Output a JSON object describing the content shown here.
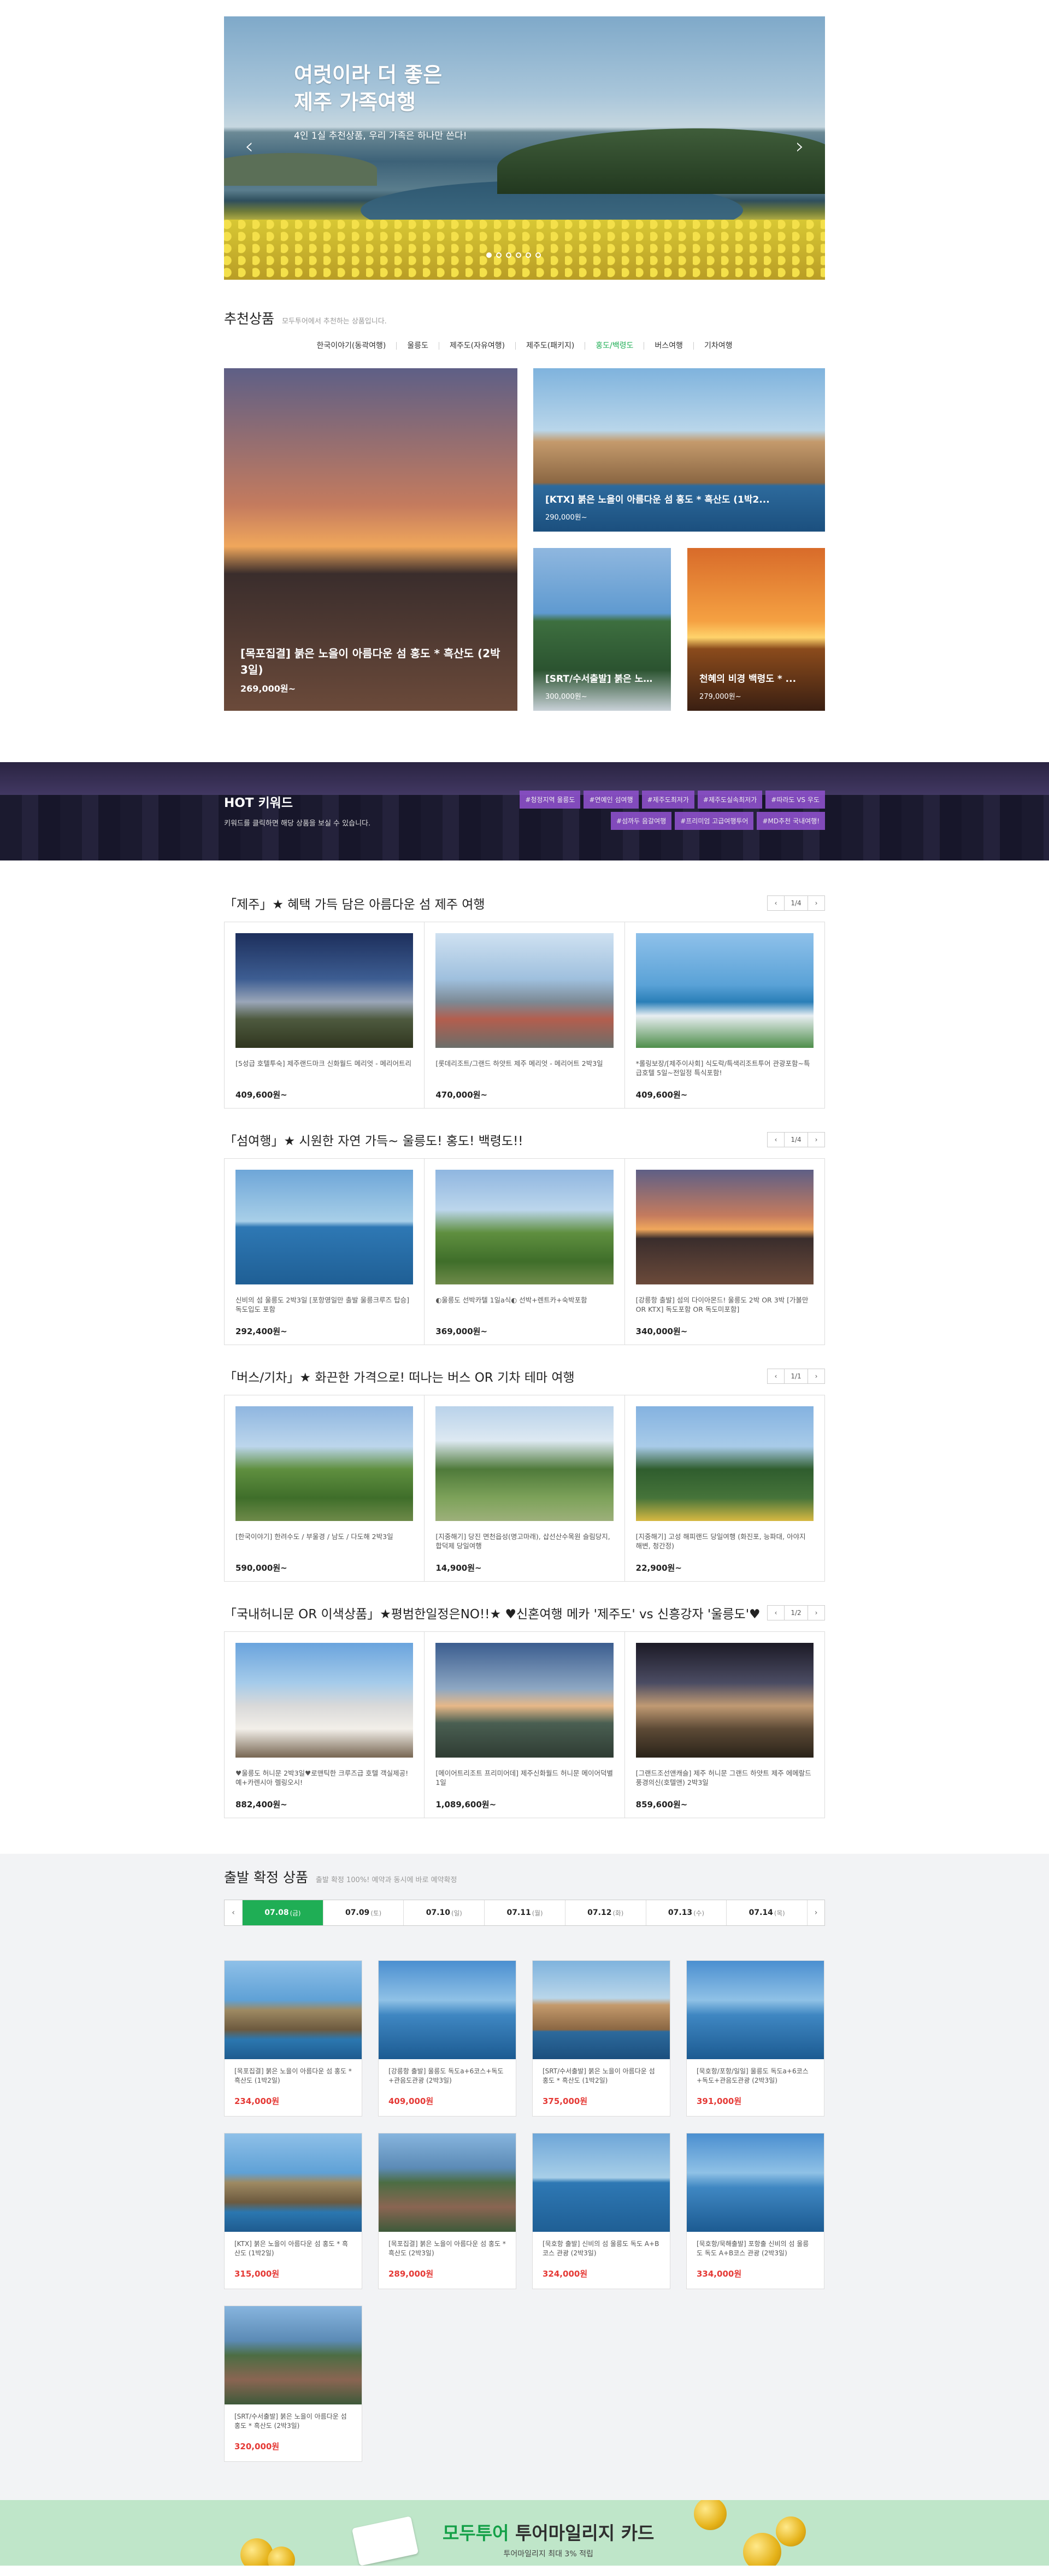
{
  "hero": {
    "title_line1": "여럿이라 더 좋은",
    "title_line2": "제주 가족여행",
    "subtitle": "4인 1실 추천상품, 우리 가족은 하나만 쓴다!",
    "prev_icon": "‹",
    "next_icon": "›",
    "slide_count": 6,
    "active_slide": 1
  },
  "recommend": {
    "title": "추천상품",
    "subtitle": "모두투어에서 추천하는 상품입니다.",
    "tabs": [
      "한국이야기(동곽여행)",
      "울릉도",
      "제주도(자유여행)",
      "제주도(패키지)",
      "홍도/백령도",
      "버스여행",
      "기차여행"
    ],
    "active_tab": "홍도/백령도",
    "cards": [
      {
        "title": "[목포집결] 붉은 노을이 아름다운 섬 홍도 * 흑산도 (2박3일)",
        "price": "269,000원~"
      },
      {
        "title": "[KTX] 붉은 노을이 아름다운 섬 홍도 * 흑산도 (1박2...",
        "price": "290,000원~"
      },
      {
        "title": "[SRT/수서출발] 붉은 노을이 아름다운 섬 홍도 * 흑산도...",
        "price": "300,000원~"
      },
      {
        "title": "천혜의 비경 백령도 * ...",
        "price": "279,000원~"
      }
    ]
  },
  "hot": {
    "title": "HOT 키워드",
    "subtitle": "키워드를 클릭하면 해당 상품을 보실 수 있습니다.",
    "tags": [
      "#청정지역 울릉도",
      "#연예인 섬여행",
      "#제주도최저가",
      "#제주도실속최저가",
      "#따라도 VS 우도",
      "#섬까두 음갈여행",
      "#프리미엄 고급여행투어",
      "#MD추천 국내여행!"
    ]
  },
  "sections": [
    {
      "title": "「제주」★ 혜택 가득 담은 아름다운 섬 제주 여행",
      "page": "1/4",
      "items": [
        {
          "title": "[5성급 호텔투숙] 제주랜드마크 신화월드 메리엇 - 메리어트리",
          "price": "409,600원~"
        },
        {
          "title": "[롯데리조트/그랜드 하얏트 제주 메리엇 - 메리어트 2박3일",
          "price": "470,000원~"
        },
        {
          "title": "*롤링보장/[제주이사회] 식도락/특색리조트투어 관광포함~특급호텔 5일~전일정 특식포함!",
          "price": "409,600원~"
        }
      ]
    },
    {
      "title": "「섬여행」★ 시원한 자연 가득~ 울릉도! 홍도! 백령도!!",
      "page": "1/4",
      "items": [
        {
          "title": "신비의 섬 울릉도 2박3일 [포항영일만 출발 울릉크루즈 탑승] 독도입도 포함",
          "price": "292,400원~"
        },
        {
          "title": "◐울릉도 선박카텔 1일a식◐ 선박+렌트카+숙박포함",
          "price": "369,000원~"
        },
        {
          "title": "[강릉항 출발] 섬의 다이아몬드! 울릉도 2박 OR 3박 [가볼만 OR KTX] 독도포함 OR 독도미포함]",
          "price": "340,000원~"
        }
      ]
    },
    {
      "title": "「버스/기차」★ 화끈한 가격으로! 떠나는 버스 OR 기차 테마 여행",
      "page": "1/1",
      "items": [
        {
          "title": "[한국이야기] 한려수도 / 부울경 / 남도 / 다도해 2박3일",
          "price": "590,000원~"
        },
        {
          "title": "[지중해기] 당진 면천읍성(명고마래), 삽선산수목원 슬림당지, 합덕제 당일여행",
          "price": "14,900원~"
        },
        {
          "title": "[지중해기] 고성 해피랜드 당일여행 (화진포, 능파대, 아야지 해변, 청간정)",
          "price": "22,900원~"
        }
      ]
    },
    {
      "title": "「국내허니문 OR 이색상품」★평범한일정은NO!!★ ♥신혼여행 메카 '제주도' vs 신흥강자 '울릉도'♥",
      "page": "1/2",
      "items": [
        {
          "title": "♥울릉도 허니문 2박3일♥로맨틱한 크루즈급 호텔 객실제공! 예+카렌시아 렐링오시!",
          "price": "882,400원~"
        },
        {
          "title": "[메이어트리조트 프리미어데] 제주신화월드 허니문 메이어덕별1일",
          "price": "1,089,600원~"
        },
        {
          "title": "[그랜드조선앤캐슬] 제주 허니문 그랜드 하얏트 제주 에메랄드 풍경의신(호텔앤) 2박3일",
          "price": "859,600원~"
        }
      ]
    }
  ],
  "confirm": {
    "title": "출발 확정 상품",
    "subtitle": "출발 확정 100%! 예약과 동시에 바로 예약확정",
    "prev_icon": "‹",
    "next_icon": "›",
    "dates": [
      {
        "date": "07.08",
        "day": "(금)"
      },
      {
        "date": "07.09",
        "day": "(토)"
      },
      {
        "date": "07.10",
        "day": "(일)"
      },
      {
        "date": "07.11",
        "day": "(월)"
      },
      {
        "date": "07.12",
        "day": "(화)"
      },
      {
        "date": "07.13",
        "day": "(수)"
      },
      {
        "date": "07.14",
        "day": "(목)"
      }
    ],
    "active_date": "07.08",
    "items": [
      {
        "title": "[목포집결] 붉은 노을이 아름다운 섬 홍도 * 흑산도 (1박2일)",
        "price": "234,000원"
      },
      {
        "title": "[강릉항 출발] 울릉도 독도a+6코스+독도+관음도관광 (2박3일)",
        "price": "409,000원"
      },
      {
        "title": "[SRT/수서출발] 붉은 노을이 아름다운 섬 홍도 * 흑산도 (1박2일)",
        "price": "375,000원"
      },
      {
        "title": "[묵호항/포항/일일] 울릉도 독도a+6코스+독도+관음도관광 (2박3일)",
        "price": "391,000원"
      },
      {
        "title": "[KTX] 붉은 노을이 아름다운 섬 홍도 * 흑산도 (1박2일)",
        "price": "315,000원"
      },
      {
        "title": "[목포집결] 붉은 노을이 아름다운 섬 홍도 * 흑산도 (2박3일)",
        "price": "289,000원"
      },
      {
        "title": "[묵호항 출발] 신비의 섬 울릉도 독도 A+B코스 관광 (2박3일)",
        "price": "324,000원"
      },
      {
        "title": "[묵호항/묵해출발] 포항출 신비의 섬 울릉도 독도 A+B코스 관광 (2박3일)",
        "price": "334,000원"
      },
      {
        "title": "[SRT/수서출발] 붉은 노을이 아름다운 섬 홍도 * 흑산도 (2박3일)",
        "price": "320,000원"
      }
    ]
  },
  "banner": {
    "brand": "모두투어",
    "title": "투어마일리지 카드",
    "subtitle": "투어마일리지 최대 3% 적립"
  }
}
